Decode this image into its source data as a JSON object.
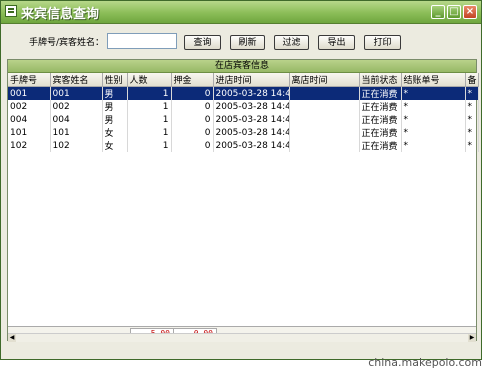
{
  "window": {
    "title": "来宾信息查询",
    "min": "_",
    "max": "□",
    "close": "×"
  },
  "search": {
    "label": "手牌号/宾客姓名：",
    "value": "",
    "buttons": {
      "query": "查询",
      "refresh": "刷新",
      "filter": "过滤",
      "export": "导出",
      "print": "打印"
    }
  },
  "grid": {
    "caption": "在店宾客信息",
    "columns": [
      "手牌号",
      "宾客姓名",
      "性别",
      "人数",
      "押金",
      "进店时间",
      "离店时间",
      "当前状态",
      "结账单号",
      "备"
    ],
    "rows": [
      [
        "001",
        "001",
        "男",
        "1",
        "0",
        "2005-03-28 14:45:",
        "",
        "正在消费",
        "*",
        "*"
      ],
      [
        "002",
        "002",
        "男",
        "1",
        "0",
        "2005-03-28 14:45:",
        "",
        "正在消费",
        "*",
        "*"
      ],
      [
        "004",
        "004",
        "男",
        "1",
        "0",
        "2005-03-28 14:45:",
        "",
        "正在消费",
        "*",
        "*"
      ],
      [
        "101",
        "101",
        "女",
        "1",
        "0",
        "2005-03-28 14:45:",
        "",
        "正在消费",
        "*",
        "*"
      ],
      [
        "102",
        "102",
        "女",
        "1",
        "0",
        "2005-03-28 14:45:",
        "",
        "正在消费",
        "*",
        "*"
      ]
    ],
    "selected_row": 0,
    "totals": {
      "people": "5.00",
      "deposit": "0.00"
    }
  },
  "watermark": "china.makepolo.com",
  "colors": {
    "title_bar": "#8bbd58",
    "selection": "#0c2a78",
    "totals_text": "#c00000"
  }
}
